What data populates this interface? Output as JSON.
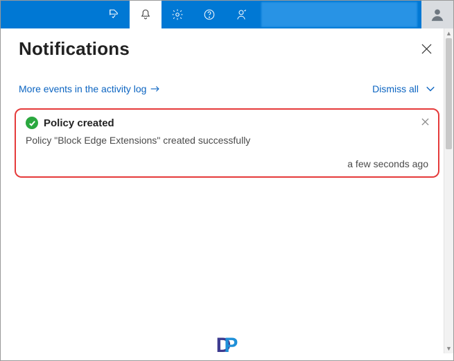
{
  "header": {
    "title": "Notifications"
  },
  "links": {
    "more_events_label": "More events in the activity log",
    "dismiss_all_label": "Dismiss all"
  },
  "notifications": [
    {
      "status": "success",
      "title": "Policy created",
      "body": "Policy \"Block Edge Extensions\" created successfully",
      "timestamp": "a few seconds ago"
    }
  ],
  "topbar": {
    "icons": [
      "flag-checkmark",
      "bell",
      "gear",
      "help",
      "feedback"
    ]
  },
  "footer_logo": {
    "left": "D",
    "right": "P"
  }
}
